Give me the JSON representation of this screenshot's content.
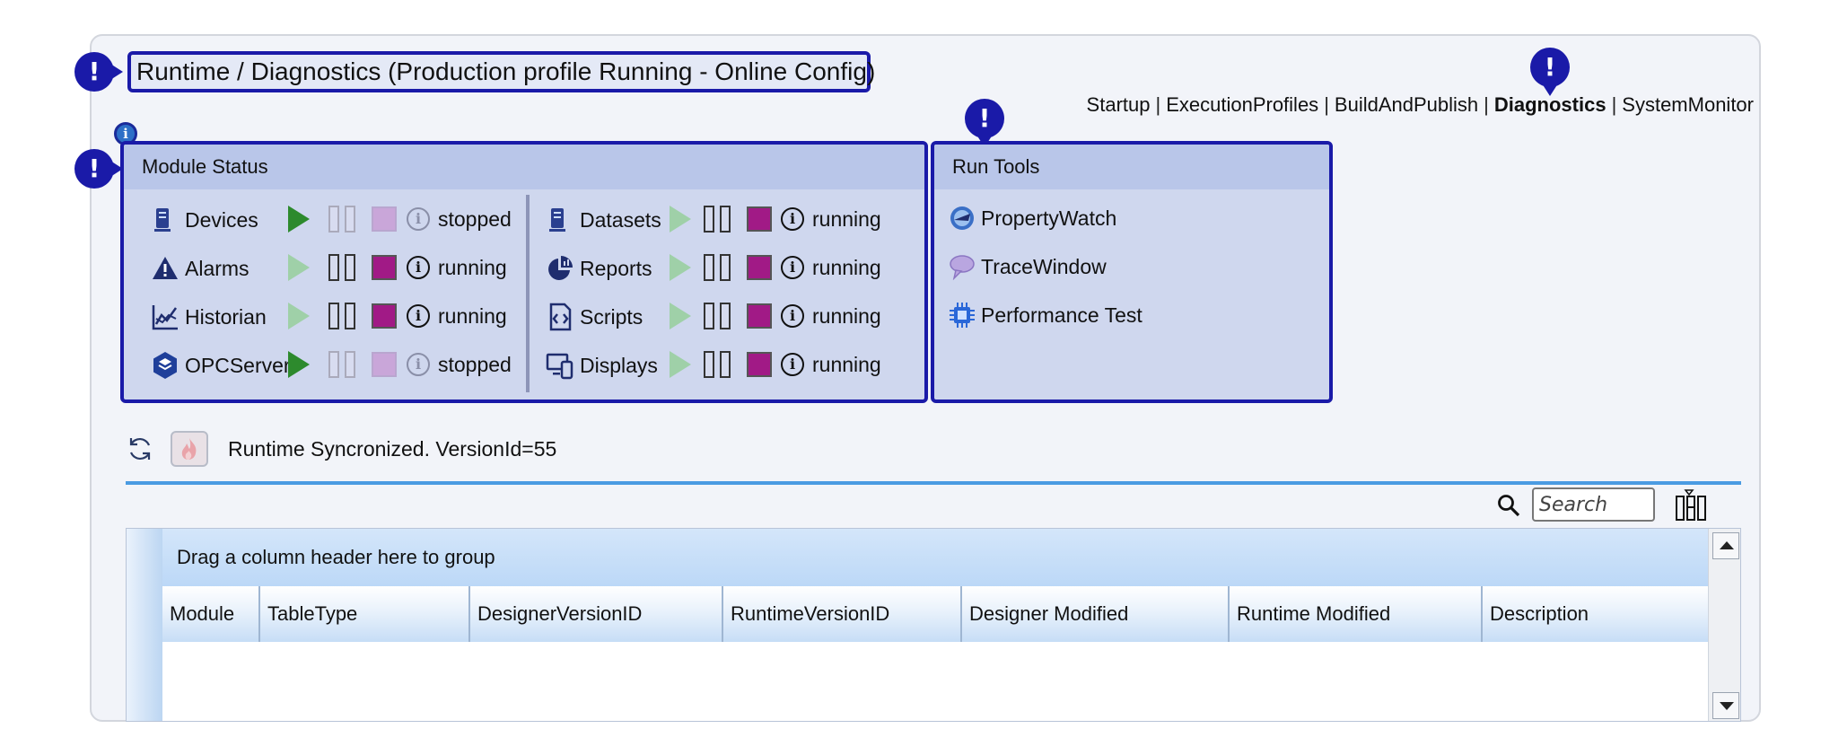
{
  "title": "Runtime / Diagnostics (Production profile Running - Online Config)",
  "nav": {
    "items": [
      {
        "label": "Startup",
        "active": false
      },
      {
        "label": "ExecutionProfiles",
        "active": false
      },
      {
        "label": "BuildAndPublish",
        "active": false
      },
      {
        "label": "Diagnostics",
        "active": true
      },
      {
        "label": "SystemMonitor",
        "active": false
      }
    ],
    "separator": "|"
  },
  "module_status": {
    "header": "Module Status",
    "left": [
      {
        "name": "Devices",
        "icon": "devices-icon",
        "state": "stopped"
      },
      {
        "name": "Alarms",
        "icon": "alarm-warning-icon",
        "state": "running"
      },
      {
        "name": "Historian",
        "icon": "historian-chart-icon",
        "state": "running"
      },
      {
        "name": "OPCServer",
        "icon": "opc-server-icon",
        "state": "stopped"
      }
    ],
    "right": [
      {
        "name": "Datasets",
        "icon": "datasets-icon",
        "state": "running"
      },
      {
        "name": "Reports",
        "icon": "reports-pie-icon",
        "state": "running"
      },
      {
        "name": "Scripts",
        "icon": "scripts-code-icon",
        "state": "running"
      },
      {
        "name": "Displays",
        "icon": "displays-devices-icon",
        "state": "running"
      }
    ]
  },
  "run_tools": {
    "header": "Run Tools",
    "items": [
      {
        "label": "PropertyWatch",
        "icon": "property-watch-icon"
      },
      {
        "label": "TraceWindow",
        "icon": "trace-window-icon"
      },
      {
        "label": "Performance Test",
        "icon": "performance-chip-icon"
      }
    ]
  },
  "sync": {
    "status": "Runtime Syncronized. VersionId=55"
  },
  "search": {
    "placeholder": "Search"
  },
  "grid": {
    "group_hint": "Drag a column header here to group",
    "columns": [
      "Module",
      "TableType",
      "DesignerVersionID",
      "RuntimeVersionID",
      "Designer Modified",
      "Runtime Modified",
      "Description"
    ],
    "rows": []
  },
  "colors": {
    "accent": "#1a1aa8",
    "play": "#2d8a2d",
    "stop": "#a11a86",
    "bar": "#4a9be2"
  }
}
